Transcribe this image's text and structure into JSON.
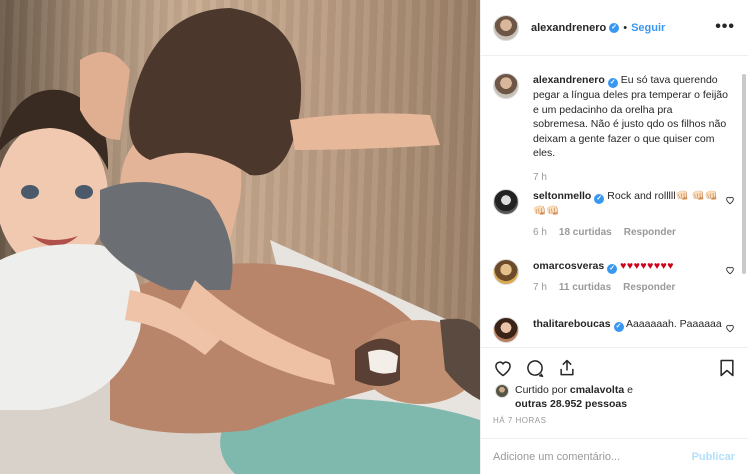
{
  "post": {
    "author": "alexandrenero",
    "follow_label": "Seguir",
    "separator": "•",
    "more_label": "•••"
  },
  "caption": {
    "username": "alexandrenero",
    "text": "Eu só tava querendo pegar a língua deles pra temperar o feijão e um pedacinho da orelha pra sobremesa. Não é justo qdo os filhos não deixam a gente fazer o que quiser com eles.",
    "time": "7 h"
  },
  "comments": [
    {
      "username": "seltonmello",
      "text": "Rock and rolllll👊🏻 👊🏻👊🏻👊🏻👊🏻",
      "time": "6 h",
      "likes": "18 curtidas",
      "reply": "Responder"
    },
    {
      "username": "omarcosveras",
      "text": "♥♥♥♥♥♥♥♥",
      "time": "7 h",
      "likes": "11 curtidas",
      "reply": "Responder"
    },
    {
      "username": "thalitareboucas",
      "text": "Aaaaaaah. Paaaaaa",
      "time": "",
      "likes": "",
      "reply": ""
    }
  ],
  "likes": {
    "prefix": "Curtido por",
    "user": "cmalavolta",
    "middle": "e",
    "others": "outras 28.952 pessoas"
  },
  "posted_ago": "HÁ 7 HORAS",
  "add_comment": {
    "placeholder": "Adicione um comentário...",
    "publish_label": "Publicar"
  },
  "colors": {
    "link_blue": "#3897f0",
    "publish_disabled": "#b2dffc",
    "muted": "#999999"
  },
  "icons": [
    "heart-icon",
    "comment-icon",
    "share-icon",
    "bookmark-icon",
    "verified-icon",
    "more-icon"
  ]
}
